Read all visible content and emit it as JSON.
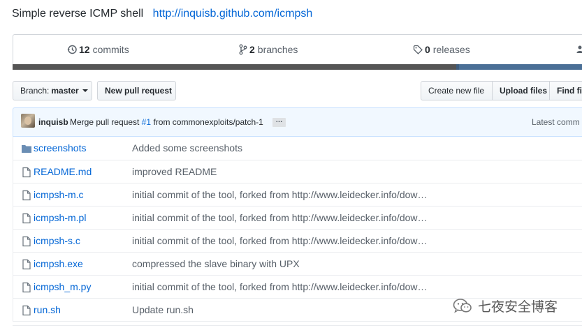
{
  "repo": {
    "description": "Simple reverse ICMP shell",
    "homepage": "http://inquisb.github.com/icmpsh"
  },
  "numbers": {
    "commits_count": "12",
    "commits_label": "commits",
    "branches_count": "2",
    "branches_label": "branches",
    "releases_count": "0",
    "releases_label": "releases"
  },
  "language_bar": {
    "colors": [
      "#555555",
      "#3e5d7e",
      "#4a6f96"
    ]
  },
  "toolbar": {
    "branch_prefix": "Branch:",
    "branch_name": "master",
    "new_pull_request": "New pull request",
    "create_new_file": "Create new file",
    "upload_files": "Upload files",
    "find_file": "Find fi"
  },
  "latest_commit": {
    "author": "inquisb",
    "message_prefix": "Merge pull request",
    "issue": "#1",
    "message_suffix": "from commonexploits/patch-1",
    "ellipsis": "…",
    "latest_label": "Latest comm"
  },
  "files": [
    {
      "name": "screenshots",
      "type": "folder-icon",
      "message": "Added some screenshots"
    },
    {
      "name": "README.md",
      "type": "file-icon",
      "message": "improved README"
    },
    {
      "name": "icmpsh-m.c",
      "type": "file-icon",
      "message": "initial commit of the tool, forked from http://www.leidecker.info/dow…"
    },
    {
      "name": "icmpsh-m.pl",
      "type": "file-icon",
      "message": "initial commit of the tool, forked from http://www.leidecker.info/dow…"
    },
    {
      "name": "icmpsh-s.c",
      "type": "file-icon",
      "message": "initial commit of the tool, forked from http://www.leidecker.info/dow…"
    },
    {
      "name": "icmpsh.exe",
      "type": "file-icon",
      "message": "compressed the slave binary with UPX"
    },
    {
      "name": "icmpsh_m.py",
      "type": "file-icon",
      "message": "initial commit of the tool, forked from http://www.leidecker.info/dow…"
    },
    {
      "name": "run.sh",
      "type": "file-icon",
      "message": "Update run.sh"
    }
  ],
  "watermark": {
    "text": "七夜安全博客"
  },
  "colors": {
    "link": "#0366d6",
    "text": "#24292e",
    "muted": "#586069",
    "border": "#d1d5da",
    "commit_bg": "#f1f8ff"
  }
}
